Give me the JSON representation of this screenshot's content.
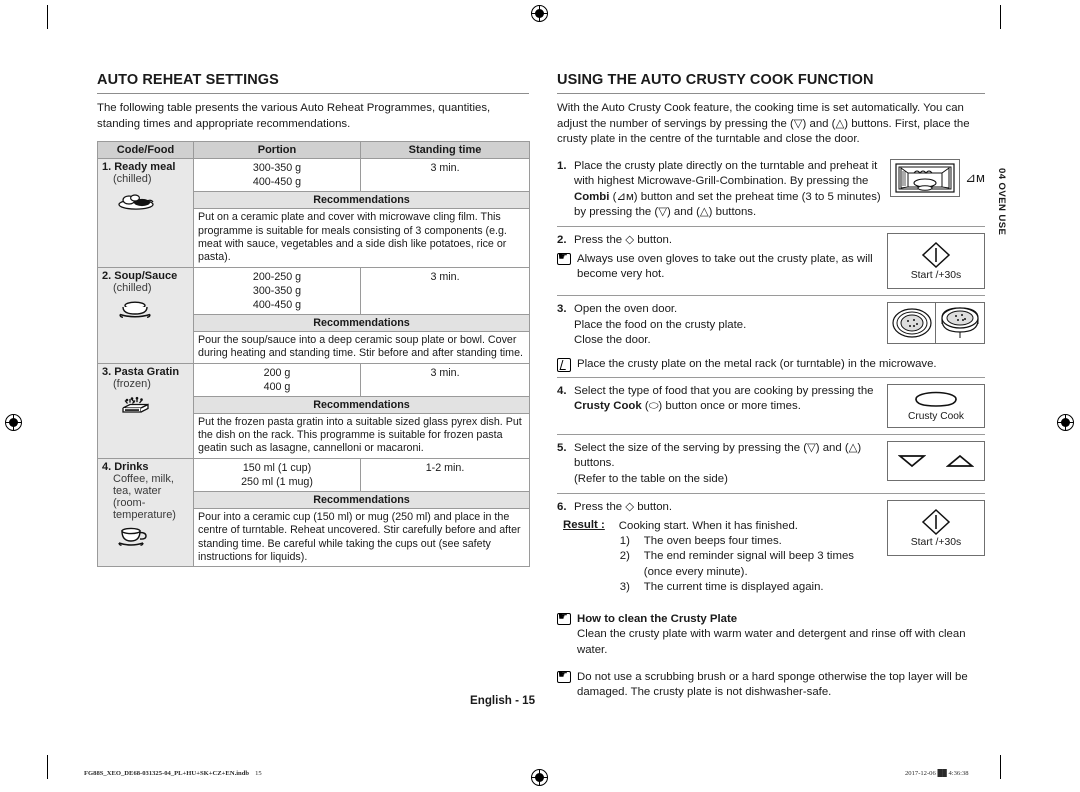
{
  "left": {
    "title": "AUTO REHEAT SETTINGS",
    "intro": "The following table presents the various Auto Reheat Programmes, quantities, standing times and appropriate recommendations.",
    "table": {
      "headers": [
        "Code/Food",
        "Portion",
        "Standing time"
      ],
      "recommendations_label": "Recommendations",
      "rows": [
        {
          "name": "1. Ready meal",
          "sub": "(chilled)",
          "icon": "ready-meal-icon",
          "portion": "300-350 g\n400-450 g",
          "standing": "3 min.",
          "recommendation": "Put on a ceramic plate and cover with microwave cling film. This programme is suitable for meals consisting of 3 components (e.g. meat with sauce, vegetables and a side dish like potatoes, rice or pasta)."
        },
        {
          "name": "2. Soup/Sauce",
          "sub": "(chilled)",
          "icon": "soup-bowl-icon",
          "portion": "200-250 g\n300-350 g\n400-450 g",
          "standing": "3 min.",
          "recommendation": "Pour the soup/sauce into a deep ceramic soup plate or bowl. Cover during heating and standing time. Stir before and after standing time."
        },
        {
          "name": "3. Pasta Gratin",
          "sub": "(frozen)",
          "icon": "pasta-gratin-icon",
          "portion": "200 g\n400 g",
          "standing": "3 min.",
          "recommendation": "Put the frozen pasta gratin into a suitable sized glass pyrex dish. Put the dish on the rack. This programme is suitable for frozen pasta geatin such as lasagne, cannelloni or macaroni."
        },
        {
          "name": "4. Drinks",
          "sub": "Coffee, milk, tea, water (room-temperature)",
          "icon": "coffee-cup-icon",
          "portion": "150 ml (1 cup)\n250 ml (1 mug)",
          "standing": "1-2 min.",
          "recommendation": "Pour into a ceramic cup (150 ml) or mug (250 ml) and place in the centre of turntable. Reheat uncovered. Stir carefully before and after standing time. Be careful while taking the cups out (see safety instructions for liquids)."
        }
      ]
    }
  },
  "right": {
    "title": "USING THE AUTO CRUSTY COOK FUNCTION",
    "intro": "With the Auto Crusty Cook feature, the cooking time is set automatically. You can adjust the number of servings by pressing the (▽) and (△) buttons. First, place the crusty plate in the centre of the turntable and close the door.",
    "steps": [
      {
        "num": "1.",
        "text_before_bold": "Place the crusty plate directly on the turntable and preheat it with highest Microwave-Grill-Combination. By pressing the ",
        "bold": "Combi",
        "text_after_bold": " (⊿ᴍ) button and set the preheat time (3 to 5 minutes) by pressing the (▽) and (△) buttons.",
        "figure": "microwave-oven-icon"
      },
      {
        "num": "2.",
        "text": "Press the ◇ button.",
        "figure": "start-button",
        "figure_caption": "Start /+30s",
        "note": "Always use oven gloves to take out the crusty plate, as will become very hot.",
        "note_icon": "hand-pointer-icon"
      },
      {
        "num": "3.",
        "text": "Open the oven door.\nPlace the food on the crusty plate.\nClose the door.",
        "figure": "crusty-plate-icons",
        "note": "Place the crusty plate on the metal rack (or turntable) in the microwave.",
        "note_icon": "note-pencil-icon"
      },
      {
        "num": "4.",
        "text_before_bold": "Select the type of food that you are cooking by pressing the ",
        "bold": "Crusty Cook",
        "text_after_bold": " (⬭) button once or more times.",
        "figure": "crusty-cook-button",
        "figure_caption": "Crusty Cook"
      },
      {
        "num": "5.",
        "text": "Select the size of the serving by pressing the (▽) and (△) buttons.\n(Refer to the table on the side)",
        "figure": "updown-arrow-buttons"
      },
      {
        "num": "6.",
        "text": "Press the ◇ button.",
        "figure": "start-button",
        "figure_caption": "Start /+30s",
        "result_label": "Result :",
        "result_intro": "Cooking start. When it has finished.",
        "result_items": [
          "The oven beeps four times.",
          "The end reminder signal will beep 3 times (once every minute).",
          "The current time is displayed again."
        ]
      }
    ],
    "cleaning": [
      {
        "title": "How to clean the Crusty Plate",
        "text": "Clean the crusty plate with warm water and detergent and rinse off with clean water.",
        "icon": "hand-pointer-icon"
      },
      {
        "title": "",
        "text": "Do not use a scrubbing brush or a hard sponge otherwise the top layer will be damaged. The crusty plate is not dishwasher-safe.",
        "icon": "hand-pointer-icon"
      }
    ]
  },
  "side_tab": "04 OVEN USE",
  "page_label": "English - 15",
  "print_footer": {
    "file": "FG88S_XEO_DE68-031325-04_PL+HU+SK+CZ+EN.indb",
    "page": "15",
    "date": "2017-12-06",
    "time": "4:36:38"
  }
}
